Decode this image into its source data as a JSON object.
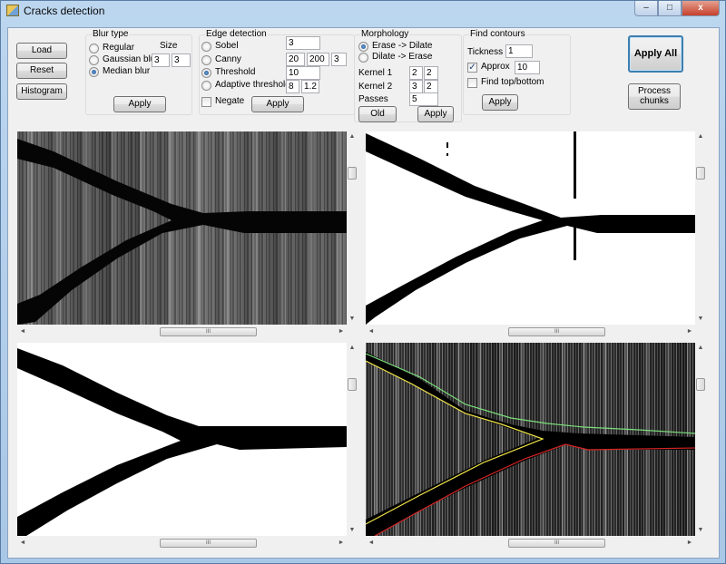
{
  "window": {
    "title": "Cracks detection",
    "controls": {
      "minimize": "–",
      "maximize": "□",
      "close": "x"
    }
  },
  "left_buttons": {
    "load": "Load",
    "reset": "Reset",
    "histogram": "Histogram"
  },
  "blur": {
    "group_title": "Blur type",
    "size_label": "Size",
    "options": [
      "Regular",
      "Gaussian blur",
      "Median blur"
    ],
    "selected": "Median blur",
    "size_x": "3",
    "size_y": "3",
    "apply": "Apply"
  },
  "edge": {
    "group_title": "Edge detection",
    "options": [
      "Sobel",
      "Canny",
      "Threshold",
      "Adaptive threshold"
    ],
    "selected": "Threshold",
    "sobel_value": "3",
    "canny_values": [
      "20",
      "200",
      "3"
    ],
    "threshold_value": "10",
    "adaptive_values": [
      "8",
      "1.2"
    ],
    "negate_label": "Negate",
    "negate_checked": false,
    "apply": "Apply"
  },
  "morphology": {
    "group_title": "Morphology",
    "options": [
      "Erase -> Dilate",
      "Dilate -> Erase"
    ],
    "selected": "Erase -> Dilate",
    "kernel1_label": "Kernel 1",
    "kernel1_values": [
      "2",
      "2"
    ],
    "kernel2_label": "Kernel 2",
    "kernel2_values": [
      "3",
      "2"
    ],
    "passes_label": "Passes",
    "passes_value": "5",
    "old": "Old",
    "apply": "Apply"
  },
  "contours": {
    "group_title": "Find contours",
    "thickness_label": "Tickness",
    "thickness_value": "1",
    "approx_label": "Approx",
    "approx_checked": true,
    "approx_value": "10",
    "find_tb_label": "Find top/bottom",
    "find_tb_checked": false,
    "apply": "Apply"
  },
  "actions": {
    "apply_all": "Apply All",
    "process_chunks": "Process chunks"
  },
  "scroll": {
    "thumb_grip": "III",
    "up": "▲",
    "down": "▼",
    "left": "◄",
    "right": "►"
  },
  "colors": {
    "contour_top": "#7adf7a",
    "contour_inner": "#f2e64a",
    "contour_bottom": "#d62424"
  }
}
